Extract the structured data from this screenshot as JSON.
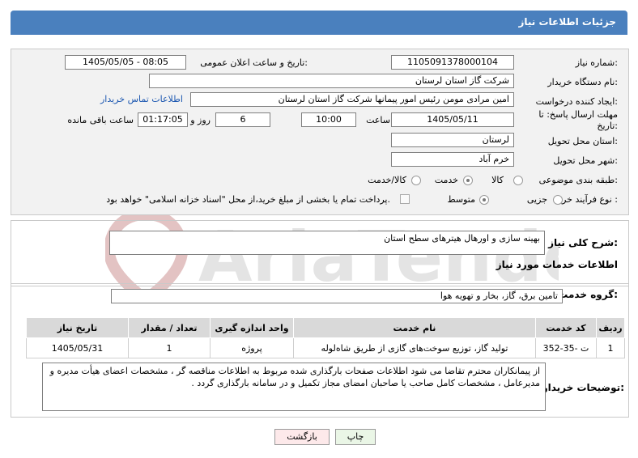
{
  "header": {
    "title": "جزئیات اطلاعات نیاز"
  },
  "fields": {
    "need_number_label": "شماره نیاز:",
    "need_number": "1105091378000104",
    "announce_label": "تاریخ و ساعت اعلان عمومی:",
    "announce_value": "1405/05/05 - 08:05",
    "buyer_org_label": "نام دستگاه خریدار:",
    "buyer_org": "شرکت گاز استان لرستان",
    "creator_label": "ایجاد کننده درخواست:",
    "creator": "امین مرادی مومن رئیس امور پیمانها شرکت گاز استان لرستان",
    "contact_link": "اطلاعات تماس خریدار",
    "deadline_label_1": "مهلت ارسال پاسخ: تا",
    "deadline_label_2": "تاریخ:",
    "deadline_date": "1405/05/11",
    "time_label": "ساعت",
    "deadline_time": "10:00",
    "days_value": "6",
    "days_label": "روز و",
    "remaining_time": "01:17:05",
    "remaining_label": "ساعت باقی مانده",
    "province_label": "استان محل تحویل:",
    "province": "لرستان",
    "city_label": "شهر محل تحویل:",
    "city": "خرم آباد",
    "category_label": "طبقه بندی موضوعی:",
    "category_options": [
      "کالا",
      "خدمت",
      "کالا/خدمت"
    ],
    "category_selected": "خدمت",
    "process_label": "نوع فرآیند خرید :",
    "process_options": [
      "جزیی",
      "متوسط"
    ],
    "process_selected": "متوسط",
    "payment_note": "پرداخت تمام یا بخشی از مبلغ خرید،از محل \"اسناد خزانه اسلامی\" خواهد بود."
  },
  "summary": {
    "label": "شرح کلی نیاز:",
    "value": "بهینه سازی و اورهال هیترهای سطح استان"
  },
  "services": {
    "section_title": "اطلاعات خدمات مورد نیاز",
    "group_label": "گروه خدمت:",
    "group_value": "تامین برق، گاز، بخار و تهویه هوا",
    "columns": [
      "ردیف",
      "کد خدمت",
      "نام خدمت",
      "واحد اندازه گیری",
      "تعداد / مقدار",
      "تاریخ نیاز"
    ],
    "rows": [
      {
        "row": "1",
        "code": "ت -35-352",
        "name": "تولید گاز، توزیع سوخت‌های گازی از طریق شاه‌لوله",
        "unit": "پروژه",
        "qty": "1",
        "date": "1405/05/31"
      }
    ]
  },
  "notes": {
    "label": "توضیحات خریدار:",
    "value": "از پیمانکاران محترم تقاضا می شود اطلاعات صفحات بارگذاری شده مربوط به اطلاعات مناقصه گر ، مشخصات اعضای هیأت مدیره و مدیرعامل ، مشخصات کامل صاحب یا صاحبان امضای مجاز تکمیل و در سامانه بارگذاری گردد ."
  },
  "buttons": {
    "print": "چاپ",
    "back": "بازگشت"
  },
  "colors": {
    "header": "#4a80be",
    "panel": "#f2f2f2",
    "back_button": "#fde9ea",
    "print_button": "#eaf6e6",
    "link": "#1a56b0"
  }
}
